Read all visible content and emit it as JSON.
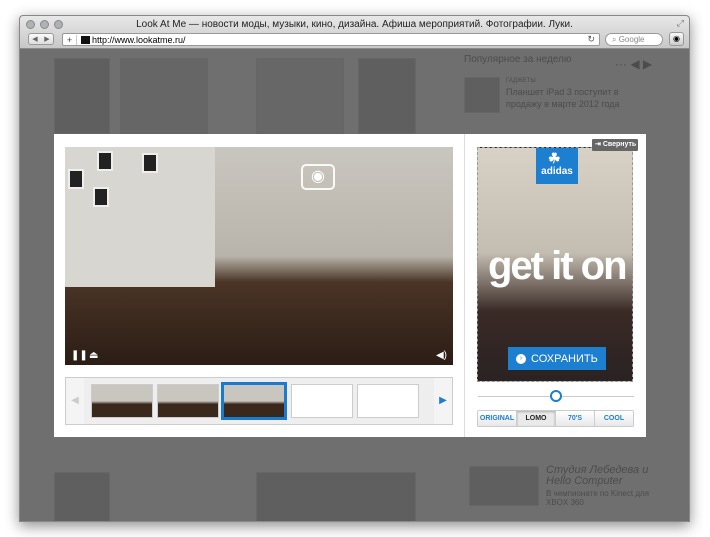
{
  "browser": {
    "title": "Look At Me — новости моды, музыки, кино, дизайна. Афиша мероприятий. Фотографии. Луки.",
    "url": "http://www.lookatme.ru/",
    "search_placeholder": "Google"
  },
  "background": {
    "popular_heading": "Популярное за неделю",
    "news_category": "ГАДЖЕТЫ",
    "news_title": "Планшет iPad 3 поступит в продажу в марте 2012 года",
    "promo_title": "Студия Лебедева и Hello Computer",
    "promo_text": "В чемпионате по Kinect для XBOX 360"
  },
  "ad": {
    "brand": "adidas",
    "slogan": "get it on",
    "save_label": "СОХРАНИТЬ",
    "collapse_label": "Свернуть",
    "filter_value": 0.5,
    "filters": [
      {
        "label": "ORIGINAL"
      },
      {
        "label": "LOMO"
      },
      {
        "label": "70'S"
      },
      {
        "label": "COOL"
      }
    ],
    "selected_filter": "LOMO"
  },
  "accent": "#1d7fcf"
}
